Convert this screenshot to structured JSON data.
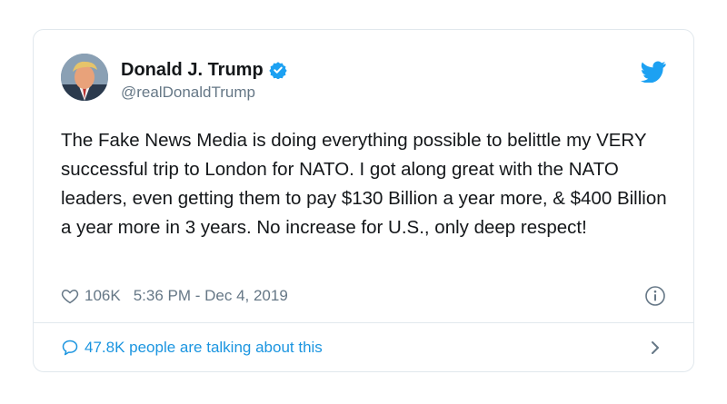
{
  "author": {
    "display_name": "Donald J. Trump",
    "handle": "@realDonaldTrump",
    "verified": true,
    "avatar_icon": "profile-photo"
  },
  "tweet": {
    "text": "The Fake News Media is doing everything possible to belittle my VERY successful trip to London for NATO. I got along great with the NATO leaders, even getting them to pay $130 Billion a year more, & $400 Billion a year more in 3 years. No increase for U.S., only deep respect!"
  },
  "meta": {
    "likes": "106K",
    "timestamp": "5:36 PM - Dec 4, 2019"
  },
  "footer": {
    "talking_label": "47.8K people are talking about this"
  },
  "icons": {
    "brand": "twitter-bird-icon",
    "verified": "verified-badge-icon",
    "like": "heart-icon",
    "info": "info-icon",
    "reply": "speech-bubble-icon",
    "more": "chevron-right-icon"
  },
  "colors": {
    "accent": "#1b95e0",
    "verified": "#1da1f2",
    "muted_text": "#657786",
    "border": "#e1e8ed"
  }
}
